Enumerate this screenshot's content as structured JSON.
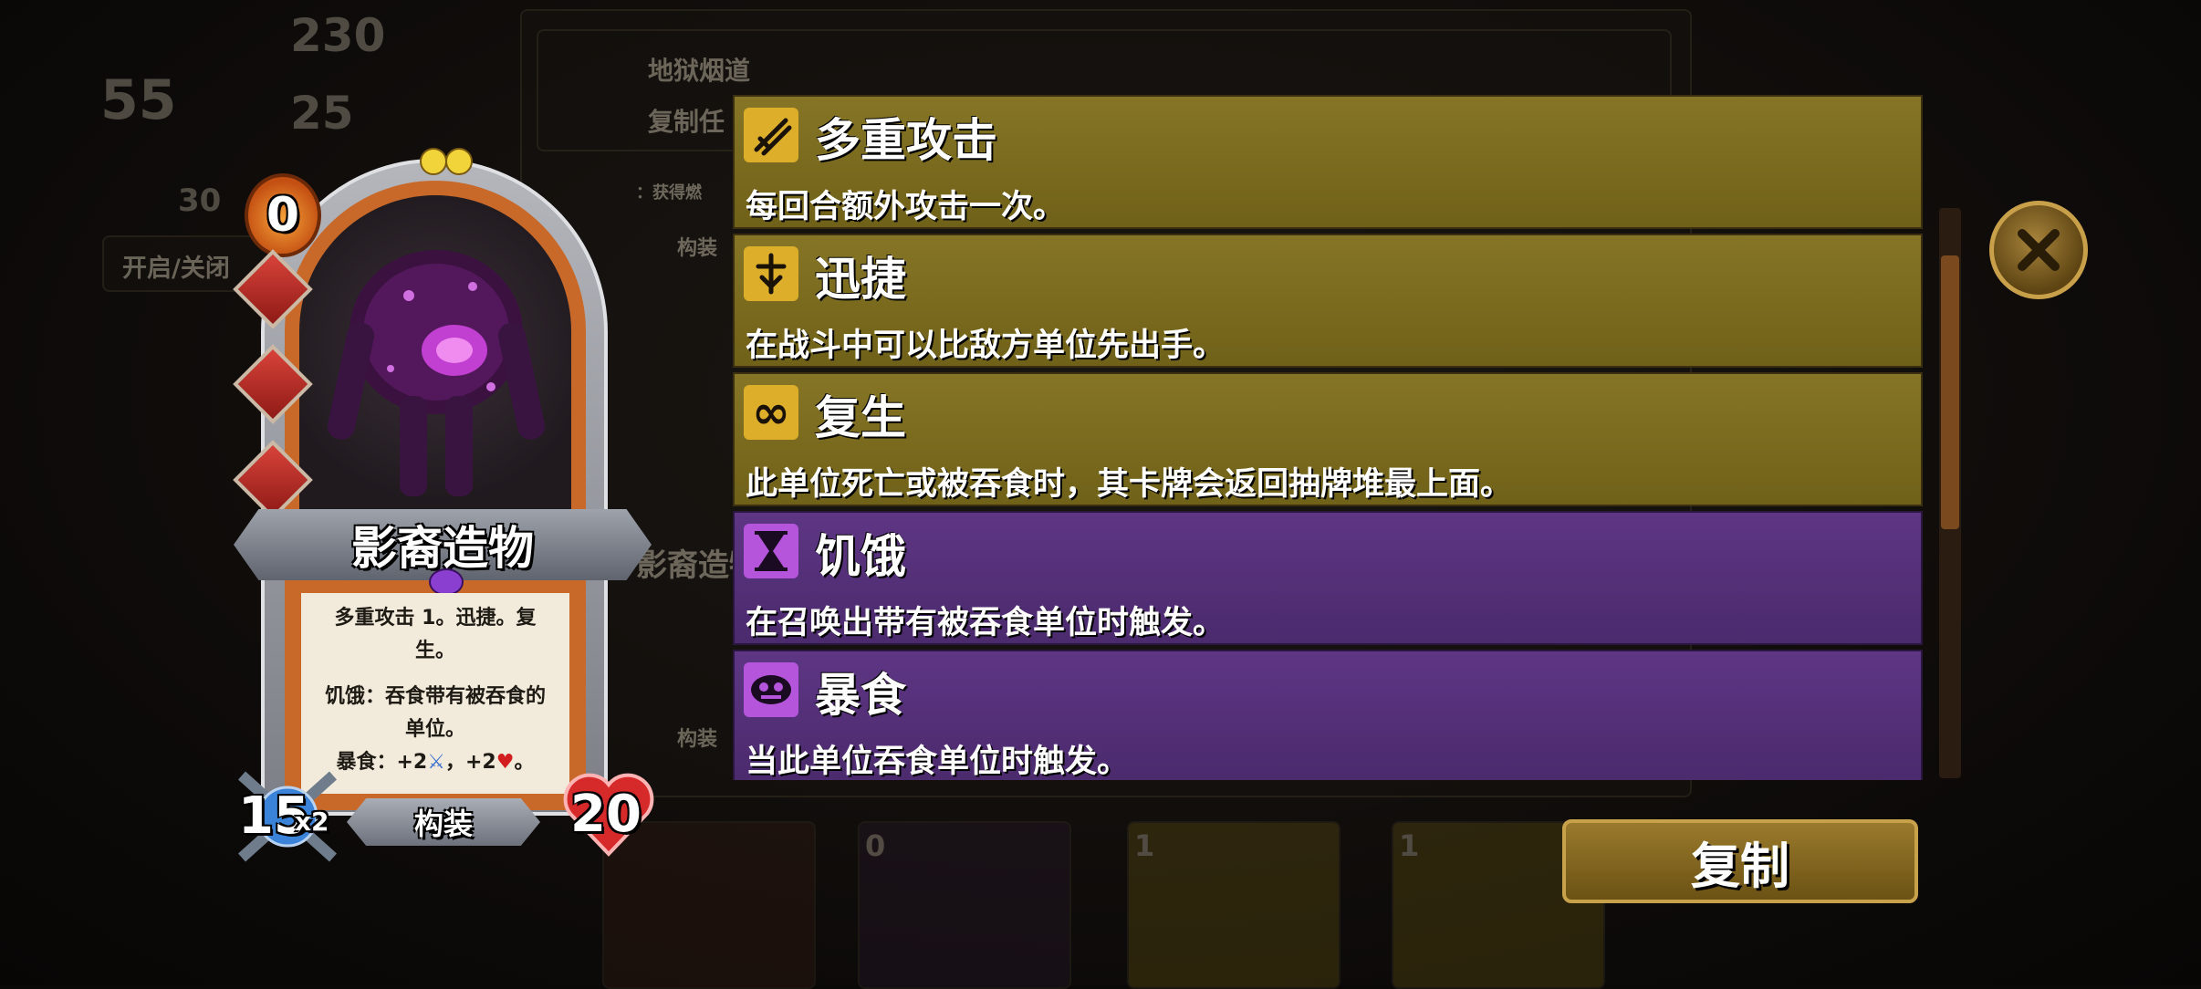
{
  "background": {
    "hp": "55",
    "gold": "230",
    "gems": "25",
    "small_count": "30",
    "toggle_button": "开启/关闭",
    "deck_title": "地狱烟道",
    "deck_copy_label": "复制任",
    "mini_desc": "：获得燃",
    "mini_type_1": "构装",
    "mini_type_2": "构装",
    "mini_card_name": "影裔造物",
    "hand_costs": [
      "0",
      "1",
      "1"
    ]
  },
  "card": {
    "cost": "0",
    "name": "影裔造物",
    "text_line1": "多重攻击 1。迅捷。复",
    "text_line2": "生。",
    "text_line3": "饥饿：吞食带有被吞食的",
    "text_line4": "单位。",
    "text_line5": "暴食：+2",
    "text_line5b": "，+2",
    "text_line5c": "。",
    "attack": "15",
    "attack_mult": "x2",
    "type": "构装",
    "health": "20"
  },
  "keywords": [
    {
      "icon": "multi-strike-icon",
      "title": "多重攻击",
      "desc": "每回合额外攻击一次。",
      "color": "gold"
    },
    {
      "icon": "swift-icon",
      "title": "迅捷",
      "desc": "在战斗中可以比敌方单位先出手。",
      "color": "gold"
    },
    {
      "icon": "infinity-icon",
      "title": "复生",
      "desc": "此单位死亡或被吞食时，其卡牌会返回抽牌堆最上面。",
      "color": "gold"
    },
    {
      "icon": "hourglass-icon",
      "title": "饥饿",
      "desc": "在召唤出带有被吞食单位时触发。",
      "color": "purple"
    },
    {
      "icon": "gluttony-icon",
      "title": "暴食",
      "desc": "当此单位吞食单位时触发。",
      "color": "purple"
    }
  ],
  "copy_button": "复制",
  "colors": {
    "gold_panel": "#867526",
    "purple_panel": "#5e3684",
    "accent": "#c7a24b"
  }
}
